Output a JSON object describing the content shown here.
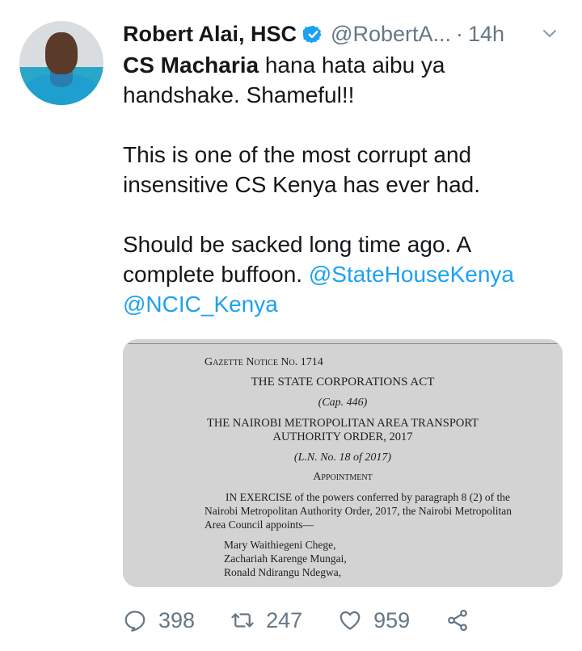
{
  "tweet": {
    "author_name": "Robert Alai, HSC",
    "handle": "@RobertA...",
    "separator": "·",
    "time": "14h",
    "line1_bold": "CS Macharia",
    "line1_rest": " hana hata aibu ya",
    "line2": "handshake. Shameful!!",
    "para2_line1": "This is one of the most corrupt and",
    "para2_line2": "insensitive CS Kenya has ever had.",
    "para3_line1": "Should be sacked long time ago. A",
    "para3_line2_plain": "complete buffoon. ",
    "mention1": "@StateHouseKenya",
    "mention2": "@NCIC_Kenya"
  },
  "document": {
    "gazette": "Gazette Notice No. 1714",
    "act": "THE STATE CORPORATIONS ACT",
    "cap": "(Cap. 446)",
    "order_line1": "THE NAIROBI METROPOLITAN AREA TRANSPORT",
    "order_line2": "AUTHORITY ORDER, 2017",
    "ln": "(L.N. No. 18 of 2017)",
    "appointment": "Appointment",
    "body_line1": "IN EXERCISE of the powers conferred by paragraph 8 (2) of the",
    "body_line2": "Nairobi Metropolitan Authority Order, 2017, the Nairobi Metropolitan",
    "body_line3": "Area Council appoints—",
    "names": [
      "Mary Waithiegeni Chege,",
      "Zachariah Karenge Mungai,",
      "Ronald Ndirangu Ndegwa,"
    ]
  },
  "stats": {
    "replies": "398",
    "retweets": "247",
    "likes": "959"
  },
  "icons": {
    "verified": "verified-badge-icon",
    "caret": "chevron-down-icon",
    "reply": "reply-icon",
    "retweet": "retweet-icon",
    "like": "heart-icon",
    "share": "share-icon"
  },
  "colors": {
    "accent": "#1da1f2",
    "muted": "#657786",
    "text": "#14171a"
  }
}
